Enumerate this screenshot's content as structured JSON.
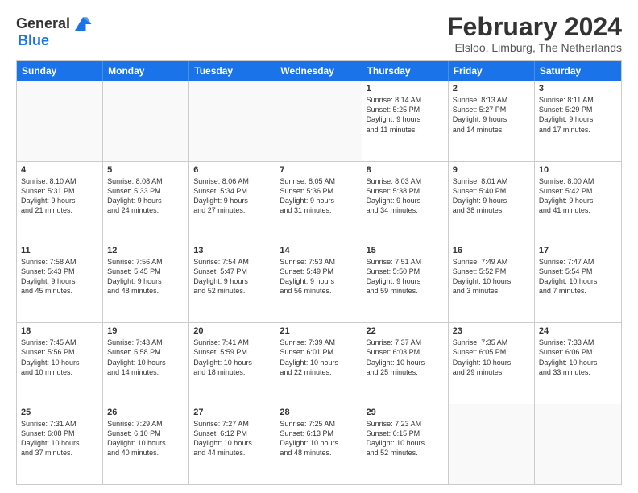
{
  "header": {
    "logo_line1": "General",
    "logo_line2": "Blue",
    "month": "February 2024",
    "location": "Elsloo, Limburg, The Netherlands"
  },
  "days_of_week": [
    "Sunday",
    "Monday",
    "Tuesday",
    "Wednesday",
    "Thursday",
    "Friday",
    "Saturday"
  ],
  "weeks": [
    [
      {
        "day": "",
        "info": ""
      },
      {
        "day": "",
        "info": ""
      },
      {
        "day": "",
        "info": ""
      },
      {
        "day": "",
        "info": ""
      },
      {
        "day": "1",
        "info": "Sunrise: 8:14 AM\nSunset: 5:25 PM\nDaylight: 9 hours\nand 11 minutes."
      },
      {
        "day": "2",
        "info": "Sunrise: 8:13 AM\nSunset: 5:27 PM\nDaylight: 9 hours\nand 14 minutes."
      },
      {
        "day": "3",
        "info": "Sunrise: 8:11 AM\nSunset: 5:29 PM\nDaylight: 9 hours\nand 17 minutes."
      }
    ],
    [
      {
        "day": "4",
        "info": "Sunrise: 8:10 AM\nSunset: 5:31 PM\nDaylight: 9 hours\nand 21 minutes."
      },
      {
        "day": "5",
        "info": "Sunrise: 8:08 AM\nSunset: 5:33 PM\nDaylight: 9 hours\nand 24 minutes."
      },
      {
        "day": "6",
        "info": "Sunrise: 8:06 AM\nSunset: 5:34 PM\nDaylight: 9 hours\nand 27 minutes."
      },
      {
        "day": "7",
        "info": "Sunrise: 8:05 AM\nSunset: 5:36 PM\nDaylight: 9 hours\nand 31 minutes."
      },
      {
        "day": "8",
        "info": "Sunrise: 8:03 AM\nSunset: 5:38 PM\nDaylight: 9 hours\nand 34 minutes."
      },
      {
        "day": "9",
        "info": "Sunrise: 8:01 AM\nSunset: 5:40 PM\nDaylight: 9 hours\nand 38 minutes."
      },
      {
        "day": "10",
        "info": "Sunrise: 8:00 AM\nSunset: 5:42 PM\nDaylight: 9 hours\nand 41 minutes."
      }
    ],
    [
      {
        "day": "11",
        "info": "Sunrise: 7:58 AM\nSunset: 5:43 PM\nDaylight: 9 hours\nand 45 minutes."
      },
      {
        "day": "12",
        "info": "Sunrise: 7:56 AM\nSunset: 5:45 PM\nDaylight: 9 hours\nand 48 minutes."
      },
      {
        "day": "13",
        "info": "Sunrise: 7:54 AM\nSunset: 5:47 PM\nDaylight: 9 hours\nand 52 minutes."
      },
      {
        "day": "14",
        "info": "Sunrise: 7:53 AM\nSunset: 5:49 PM\nDaylight: 9 hours\nand 56 minutes."
      },
      {
        "day": "15",
        "info": "Sunrise: 7:51 AM\nSunset: 5:50 PM\nDaylight: 9 hours\nand 59 minutes."
      },
      {
        "day": "16",
        "info": "Sunrise: 7:49 AM\nSunset: 5:52 PM\nDaylight: 10 hours\nand 3 minutes."
      },
      {
        "day": "17",
        "info": "Sunrise: 7:47 AM\nSunset: 5:54 PM\nDaylight: 10 hours\nand 7 minutes."
      }
    ],
    [
      {
        "day": "18",
        "info": "Sunrise: 7:45 AM\nSunset: 5:56 PM\nDaylight: 10 hours\nand 10 minutes."
      },
      {
        "day": "19",
        "info": "Sunrise: 7:43 AM\nSunset: 5:58 PM\nDaylight: 10 hours\nand 14 minutes."
      },
      {
        "day": "20",
        "info": "Sunrise: 7:41 AM\nSunset: 5:59 PM\nDaylight: 10 hours\nand 18 minutes."
      },
      {
        "day": "21",
        "info": "Sunrise: 7:39 AM\nSunset: 6:01 PM\nDaylight: 10 hours\nand 22 minutes."
      },
      {
        "day": "22",
        "info": "Sunrise: 7:37 AM\nSunset: 6:03 PM\nDaylight: 10 hours\nand 25 minutes."
      },
      {
        "day": "23",
        "info": "Sunrise: 7:35 AM\nSunset: 6:05 PM\nDaylight: 10 hours\nand 29 minutes."
      },
      {
        "day": "24",
        "info": "Sunrise: 7:33 AM\nSunset: 6:06 PM\nDaylight: 10 hours\nand 33 minutes."
      }
    ],
    [
      {
        "day": "25",
        "info": "Sunrise: 7:31 AM\nSunset: 6:08 PM\nDaylight: 10 hours\nand 37 minutes."
      },
      {
        "day": "26",
        "info": "Sunrise: 7:29 AM\nSunset: 6:10 PM\nDaylight: 10 hours\nand 40 minutes."
      },
      {
        "day": "27",
        "info": "Sunrise: 7:27 AM\nSunset: 6:12 PM\nDaylight: 10 hours\nand 44 minutes."
      },
      {
        "day": "28",
        "info": "Sunrise: 7:25 AM\nSunset: 6:13 PM\nDaylight: 10 hours\nand 48 minutes."
      },
      {
        "day": "29",
        "info": "Sunrise: 7:23 AM\nSunset: 6:15 PM\nDaylight: 10 hours\nand 52 minutes."
      },
      {
        "day": "",
        "info": ""
      },
      {
        "day": "",
        "info": ""
      }
    ]
  ]
}
